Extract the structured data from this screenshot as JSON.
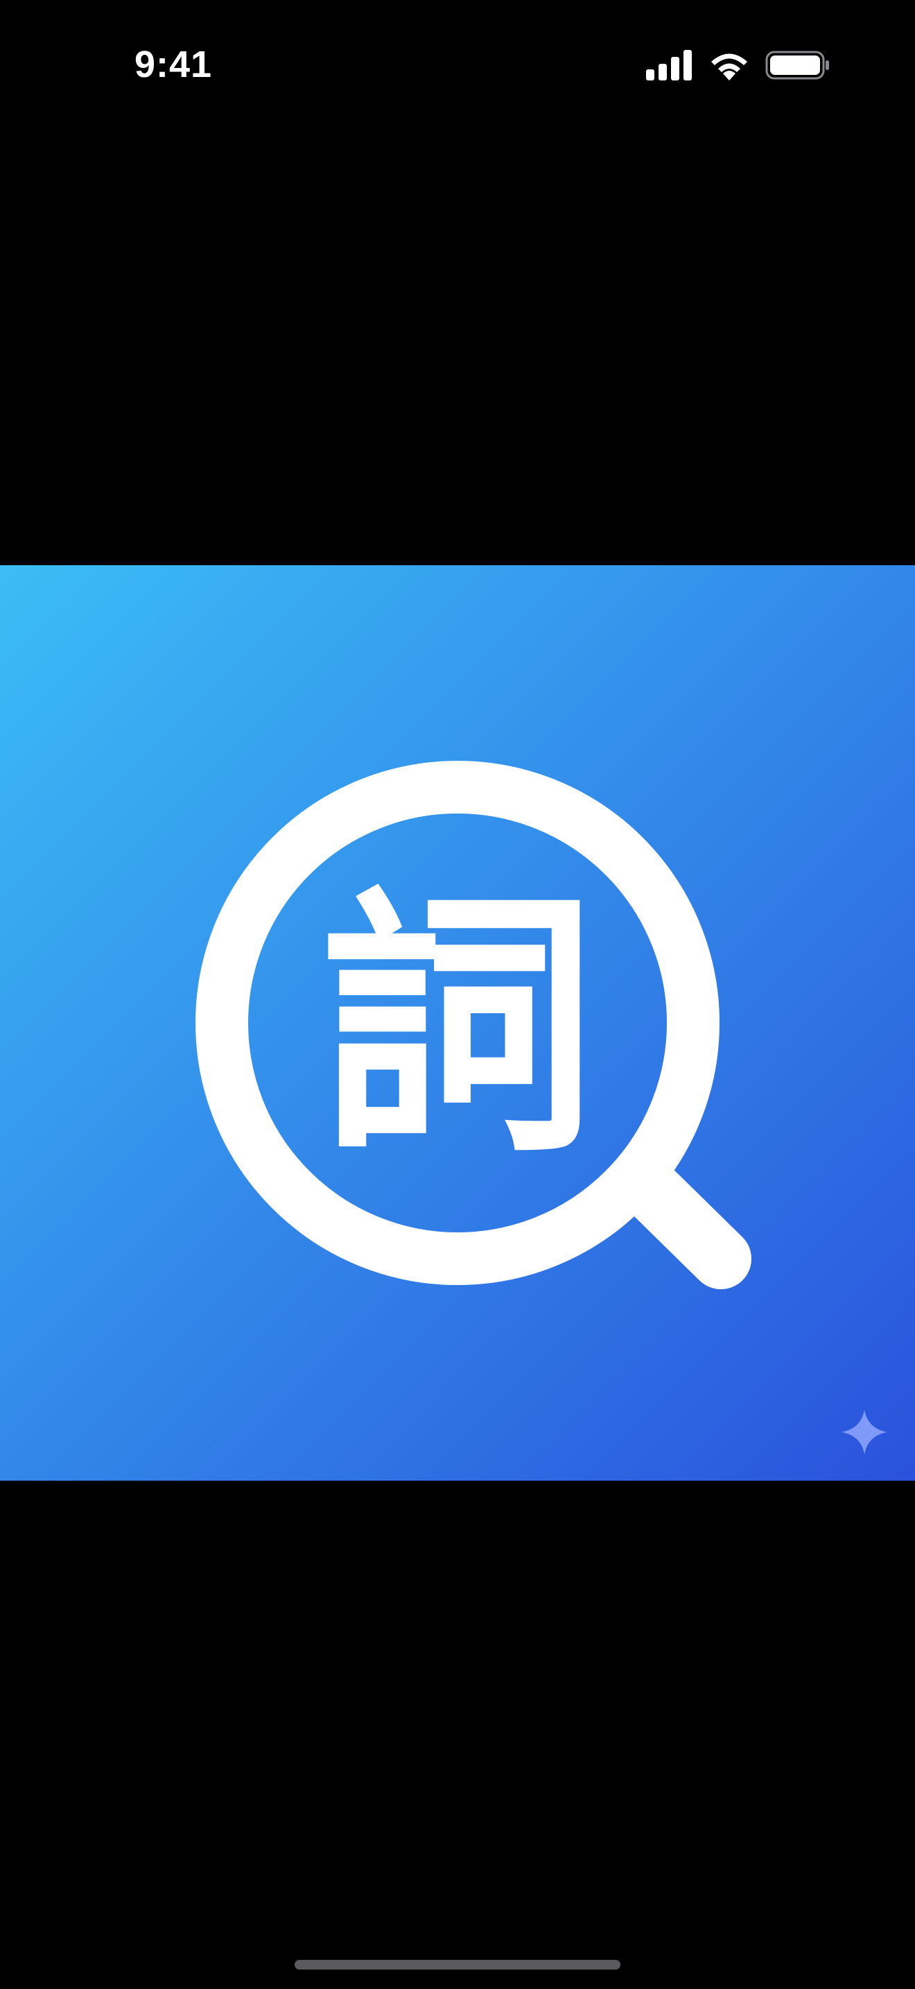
{
  "status_bar": {
    "time": "9:41",
    "icons": [
      "cellular-signal-icon",
      "wifi-icon",
      "battery-icon"
    ]
  },
  "artwork": {
    "glyph": "詞",
    "icon": "magnifying-glass-icon",
    "badge_icon": "sparkle-icon",
    "colors": {
      "gradient_start": "#3bbdf6",
      "gradient_end": "#2a52dc",
      "foreground": "#ffffff"
    }
  },
  "colors": {
    "background": "#000000",
    "home_indicator": "#5a5a5e"
  }
}
